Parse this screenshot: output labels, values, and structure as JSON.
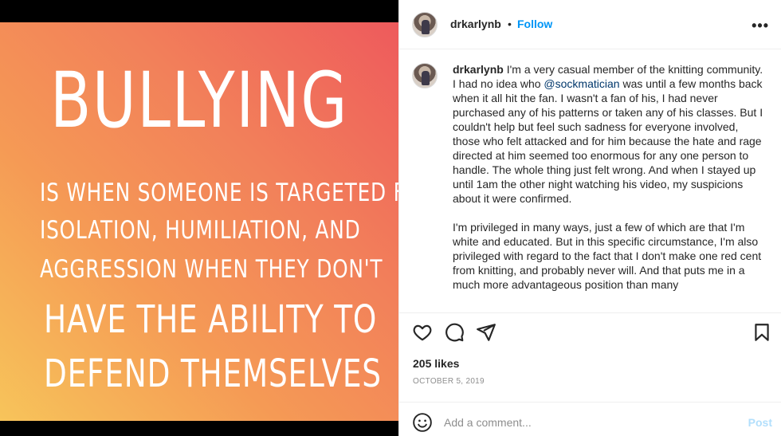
{
  "image": {
    "title": "BULLYING",
    "line1": "IS WHEN SOMEONE IS TARGETED FOR",
    "line2": "ISOLATION, HUMILIATION, AND",
    "line3": "AGGRESSION WHEN THEY DON'T",
    "line4": "HAVE THE ABILITY TO",
    "line5": "DEFEND THEMSELVES",
    "gradient_colors": [
      "#f7c45a",
      "#f59a55",
      "#f2805a",
      "#ee5a5c"
    ]
  },
  "header": {
    "username": "drkarlynb",
    "separator": "•",
    "follow_label": "Follow",
    "more_icon": "more-horizontal-icon"
  },
  "caption": {
    "username": "drkarlynb",
    "p1_before": " I'm a very casual member of the knitting community. I had no idea who ",
    "mention": "@sockmatician",
    "p1_after": " was until a few months back when it all hit the fan. I wasn't a fan of his, I had never purchased any of his patterns or taken any of his classes. But I couldn't help but feel such sadness for everyone involved, those who felt attacked and for him because the hate and rage directed at him seemed too enormous for any one person to handle. The whole thing just felt wrong. And when I stayed up until 1am the other night watching his video, my suspicions about it were confirmed.",
    "p2": "I'm privileged in many ways, just a few of which are that I'm white and educated. But in this specific circumstance, I'm also privileged with regard to the fact that I don't make one red cent from knitting, and probably never will. And that puts me in a much more advantageous position than many"
  },
  "actions": {
    "like_icon": "heart-icon",
    "comment_icon": "comment-bubble-icon",
    "share_icon": "paper-plane-icon",
    "save_icon": "bookmark-icon"
  },
  "likes": "205 likes",
  "date": "OCTOBER 5, 2019",
  "comment": {
    "placeholder": "Add a comment...",
    "post_label": "Post",
    "emoji_icon": "smiley-icon"
  },
  "colors": {
    "accent": "#0095f6",
    "post_disabled": "#b2dffc",
    "muted": "#8e8e8e",
    "mention": "#00376b"
  }
}
